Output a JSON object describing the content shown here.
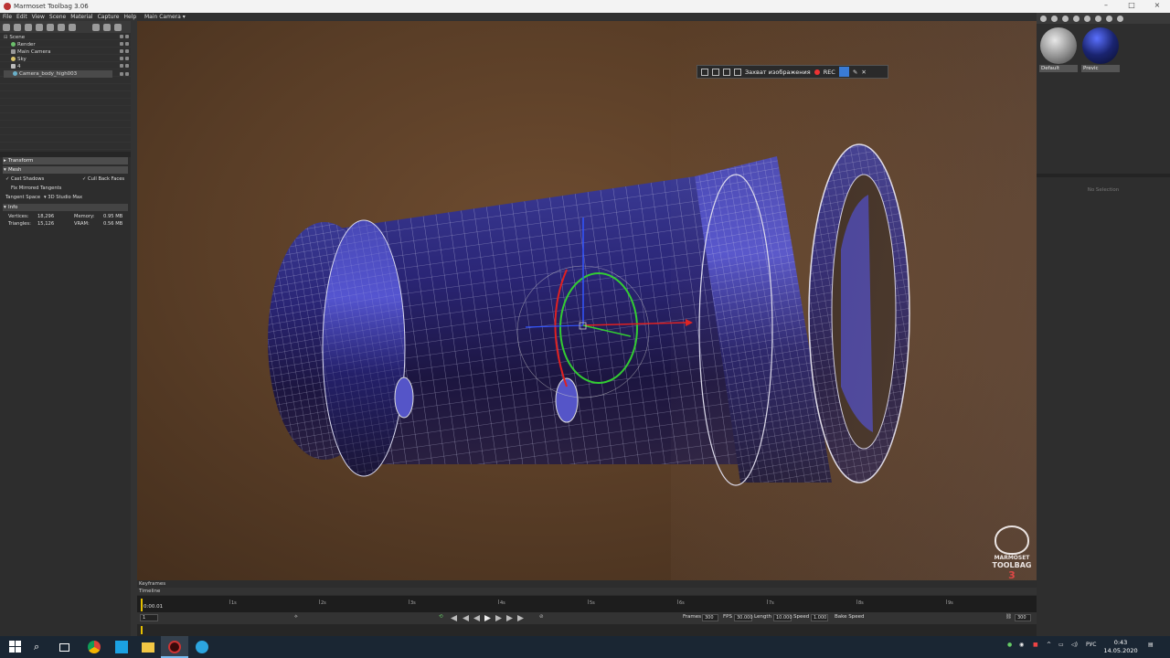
{
  "window": {
    "title": "Marmoset Toolbag 3.06"
  },
  "menu": [
    "File",
    "Edit",
    "View",
    "Scene",
    "Material",
    "Capture",
    "Help"
  ],
  "viewport": {
    "camera_tab": "Main Camera"
  },
  "scene_tree": {
    "items": [
      {
        "label": "Scene",
        "indent": 0
      },
      {
        "label": "Render",
        "indent": 1
      },
      {
        "label": "Main Camera",
        "indent": 1
      },
      {
        "label": "Sky",
        "indent": 1
      },
      {
        "label": "4",
        "indent": 1
      },
      {
        "label": "Camera_body_high003",
        "indent": 2
      }
    ],
    "selected": "Camera_body_high003"
  },
  "properties": {
    "transform_header": "Transform",
    "mesh_header": "Mesh",
    "cast_shadows": "Cast Shadows",
    "cull_back_faces": "Cull Back Faces",
    "fix_mirrored": "Fix Mirrored Tangents",
    "tangent_space_label": "Tangent Space",
    "tangent_space_value": "3D Studio Max",
    "info_header": "Info",
    "vertices_label": "Vertices:",
    "vertices_value": "18,296",
    "triangles_label": "Triangles:",
    "triangles_value": "15,126",
    "memory_label": "Memory:",
    "memory_value": "0.95 MB",
    "vram_label": "VRAM:",
    "vram_value": "0.56 MB"
  },
  "capture_bar": {
    "label": "Захват изображения",
    "rec": "REC"
  },
  "materials": [
    {
      "label": "Default",
      "color": "#9a9a9a"
    },
    {
      "label": "Previc",
      "color": "#1a2a70"
    }
  ],
  "right_panel": {
    "no_selection": "No Selection"
  },
  "watermark": {
    "line1": "MARMOSET",
    "line2": "TOOLBAG",
    "version": "3"
  },
  "timeline": {
    "keyframes_label": "Keyframes",
    "timeline_label": "Timeline",
    "current_time": "0:00.01",
    "ticks": [
      "1s",
      "2s",
      "3s",
      "4s",
      "5s",
      "6s",
      "7s",
      "8s",
      "9s"
    ],
    "frame_field": "1",
    "frames_label": "Frames",
    "frames_value": "300",
    "fps_label": "FPS",
    "fps_value": "30.000",
    "length_label": "Length",
    "length_value": "10.000",
    "speed_label": "Speed",
    "speed_value": "1.000",
    "bake_speed": "Bake Speed",
    "end_value": "300"
  },
  "taskbar": {
    "lang": "РУС",
    "time": "0:43",
    "date": "14.05.2020"
  },
  "colors": {
    "accent": "#3a7bd5",
    "mesh": "#2a2a8a",
    "bg_brown": "#5a3f28",
    "rec": "#e33333"
  }
}
